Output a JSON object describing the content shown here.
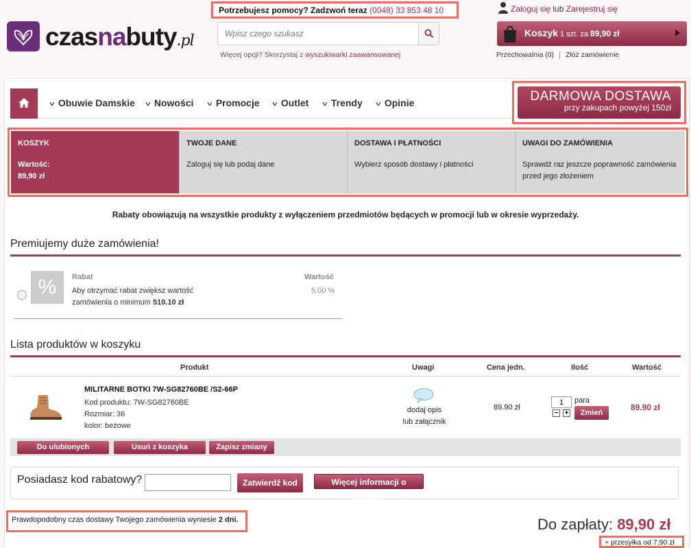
{
  "header": {
    "help_text": "Potrzebujesz pomocy? Zadzwoń teraz",
    "phone": "(0048) 33 853 48 10",
    "logo": {
      "part1": "czas",
      "part2": "na",
      "part3": "buty",
      "suffix": ".pl"
    },
    "search_placeholder": "Wpisz czego szukasz",
    "adv_prefix": "Więcej opcji? Skorzystaj z",
    "adv_link": "wyszukiwarki zaawansowanej",
    "login_link": "Zaloguj się",
    "login_or": "lub",
    "register_link": "Zarejestruj się",
    "cart_label": "Koszyk",
    "cart_items": "1 szt. za",
    "cart_total": "89,90 zł",
    "storage_link": "Przechowalnia (0)",
    "order_link": "Złóż zamówienie"
  },
  "nav": {
    "items": [
      "Obuwie Damskie",
      "Nowości",
      "Promocje",
      "Outlet",
      "Trendy",
      "Opinie"
    ]
  },
  "free_shipping": {
    "title": "DARMOWA DOSTAWA",
    "subtitle": "przy zakupach powyżej 150zł"
  },
  "steps": [
    {
      "title": "KOSZYK",
      "line1": "Wartość:",
      "line2": "89,90 zł"
    },
    {
      "title": "TWOJE DANE",
      "line1": "Zaloguj się lub podaj dane",
      "line2": ""
    },
    {
      "title": "DOSTAWA I PŁATNOŚCI",
      "line1": "Wybierz sposób dostawy i płatności",
      "line2": ""
    },
    {
      "title": "UWAGI DO ZAMÓWIENIA",
      "line1": "Sprawdź raz jeszcze poprawność zamówienia",
      "line2": "przed jego złożeniem"
    }
  ],
  "promo_note": "Rabaty obowiązują na wszystkie produkty z wyłączeniem przedmiotów będących w promocji lub w okresie wyprzedaży.",
  "premium": {
    "title": "Premiujemy duże zamówienia!",
    "icon_glyph": "%",
    "rabat_header": "Rabat",
    "rabat_desc": "Aby otrzymać rabat zwiększ wartość zamówienia o minimum",
    "rabat_amount": "510.10 zł",
    "value_header": "Wartość",
    "value": "5.00 %"
  },
  "cart": {
    "title": "Lista produktów w koszyku",
    "headers": {
      "product": "Produkt",
      "notes": "Uwagi",
      "unit_price": "Cena jedn.",
      "qty": "Ilość",
      "value": "Wartość"
    },
    "item": {
      "name": "MILITARNE BOTKI 7W-SG82760BE /S2-66P",
      "code": "Kod produktu: 7W-SG82760BE",
      "size": "Rozmiar: 36",
      "color": "kolor: beżowe",
      "note_link_1": "dodaj opis",
      "note_link_2": "lub załącznik",
      "unit_price": "89.90 zł",
      "qty": "1",
      "qty_unit": "para",
      "change_btn": "Zmień",
      "total": "89.90 zł"
    },
    "buttons": {
      "favorites": "Do ulubionych",
      "remove": "Usuń z koszyka",
      "save": "Zapisz zmiany"
    }
  },
  "coupon": {
    "label": "Posiadasz kod rabatowy?",
    "confirm": "Zatwierdź kod",
    "more": "Więcej informacji o rabatach"
  },
  "delivery": {
    "text": "Prawdopodobny czas dostawy Twojego zamówienia wyniesie",
    "days": "2 dni."
  },
  "summary": {
    "label": "Do zapłaty:",
    "amount": "89,90 zł",
    "shipping": "+ przesyłka od 7,90 zł"
  },
  "colors": {
    "accent": "#a33b56",
    "brand_purple": "#6b2e79",
    "highlight_border": "#e8705e"
  }
}
